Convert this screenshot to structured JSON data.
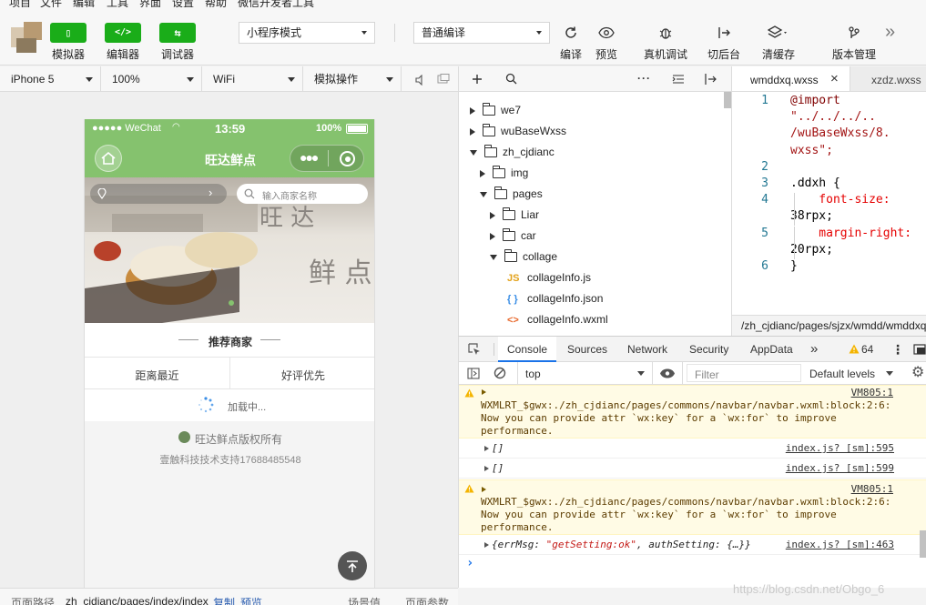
{
  "menu": [
    "项目",
    "文件",
    "编辑",
    "工具",
    "界面",
    "设置",
    "帮助",
    "微信开发者工具"
  ],
  "toolbar": {
    "simulator_label": "模拟器",
    "editor_label": "编辑器",
    "debugger_label": "调试器",
    "simulator_glyph": "▯",
    "editor_glyph": "</>",
    "debugger_glyph": "⇆",
    "mode_select": "小程序模式",
    "compile_select": "普通编译",
    "compile_label": "编译",
    "preview_label": "预览",
    "remote_debug_label": "真机调试",
    "backend_label": "切后台",
    "cache_label": "清缓存",
    "version_label": "版本管理",
    "more_glyph": "»"
  },
  "device_bar": {
    "device": "iPhone 5",
    "zoom": "100%",
    "network": "WiFi",
    "operation": "模拟操作"
  },
  "phone": {
    "carrier": "●●●●● WeChat",
    "time": "13:59",
    "battery": "100%",
    "title": "旺达鲜点",
    "search_placeholder": "输入商家名称",
    "banner_text_1": "旺 达",
    "banner_text_2": "鲜 点",
    "section_title": "推荐商家",
    "tab_nearest": "距离最近",
    "tab_rating": "好评优先",
    "loading": "加载中...",
    "copyright": "旺达鲜点版权所有",
    "support": "壹触科技技术支持17688485548"
  },
  "bottom_bar": {
    "path_label": "页面路径",
    "path_value": "zh_cjdianc/pages/index/index",
    "copy": "复制",
    "preview": "预览",
    "scene": "场景值",
    "params": "页面参数"
  },
  "file_tree": [
    {
      "name": "we7",
      "depth": 0,
      "expanded": false,
      "kind": "folder"
    },
    {
      "name": "wuBaseWxss",
      "depth": 0,
      "expanded": false,
      "kind": "folder"
    },
    {
      "name": "zh_cjdianc",
      "depth": 0,
      "expanded": true,
      "kind": "folder"
    },
    {
      "name": "img",
      "depth": 1,
      "expanded": false,
      "kind": "folder"
    },
    {
      "name": "pages",
      "depth": 1,
      "expanded": true,
      "kind": "folder"
    },
    {
      "name": "Liar",
      "depth": 2,
      "expanded": false,
      "kind": "folder"
    },
    {
      "name": "car",
      "depth": 2,
      "expanded": false,
      "kind": "folder"
    },
    {
      "name": "collage",
      "depth": 2,
      "expanded": true,
      "kind": "folder"
    },
    {
      "name": "collageInfo.js",
      "depth": 3,
      "kind": "js",
      "badge": "JS"
    },
    {
      "name": "collageInfo.json",
      "depth": 3,
      "kind": "json",
      "badge": "{ }"
    },
    {
      "name": "collageInfo.wxml",
      "depth": 3,
      "kind": "wxml",
      "badge": "<>"
    }
  ],
  "editor": {
    "active_tab": "wmddxq.wxss",
    "other_tab": "xzdz.wxss",
    "close_glyph": "×",
    "lines": [
      {
        "n": "1",
        "text": "@import"
      },
      {
        "n": "",
        "text": "\"../../../.."
      },
      {
        "n": "",
        "text": "/wuBaseWxss/8."
      },
      {
        "n": "",
        "text": "wxss\";"
      },
      {
        "n": "2",
        "text": ""
      },
      {
        "n": "3",
        "text": ".ddxh {"
      },
      {
        "n": "4",
        "text": "    font-size:"
      },
      {
        "n": "",
        "text": "38rpx;"
      },
      {
        "n": "5",
        "text": "    margin-right:"
      },
      {
        "n": "",
        "text": "20rpx;"
      },
      {
        "n": "6",
        "text": "}"
      }
    ],
    "path": "/zh_cjdianc/pages/sjzx/wmdd/wmddxq.wxss"
  },
  "console": {
    "tabs": [
      "Console",
      "Sources",
      "Network",
      "Security",
      "AppData"
    ],
    "more_glyph": "»",
    "warning_count": "64",
    "context": "top",
    "filter_placeholder": "Filter",
    "levels": "Default levels",
    "messages": [
      {
        "type": "warn",
        "source": "VM805:1",
        "lines": [
          "WXMLRT_$gwx:./zh_cjdianc/pages/commons/navbar/navbar.wxml:block:2:6:",
          "Now you can provide attr `wx:key` for a `wx:for` to improve",
          "performance."
        ]
      },
      {
        "type": "log",
        "source": "index.js? [sm]:595",
        "text": "[]"
      },
      {
        "type": "log",
        "source": "index.js? [sm]:599",
        "text": "[]"
      },
      {
        "type": "warn",
        "source": "VM805:1",
        "lines": [
          "WXMLRT_$gwx:./zh_cjdianc/pages/commons/navbar/navbar.wxml:block:2:6:",
          "Now you can provide attr `wx:key` for a `wx:for` to improve",
          "performance."
        ]
      },
      {
        "type": "log",
        "source": "index.js? [sm]:463",
        "text_prefix": "{errMsg: ",
        "text_string": "\"getSetting:ok\"",
        "text_suffix": ", authSetting: {…}}"
      }
    ],
    "prompt": "›"
  },
  "watermark": "https://blog.csdn.net/Obgo_6",
  "colors": {
    "accent_green": "#1aad19",
    "phone_green": "#85c26e",
    "warn_bg": "#fffbe5"
  }
}
